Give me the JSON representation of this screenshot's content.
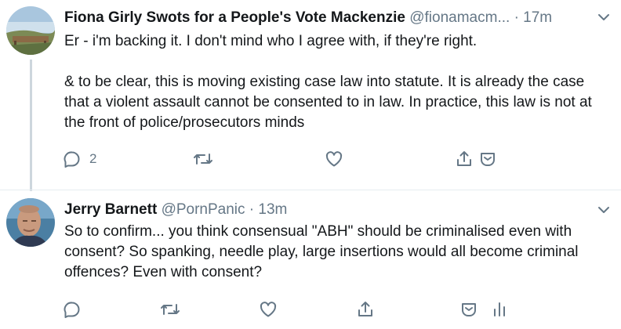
{
  "tweets": [
    {
      "display_name": "Fiona Girly Swots for a People's Vote Mackenzie",
      "handle": "@fionamacm...",
      "separator": "·",
      "time": "17m",
      "text": "Er - i'm backing it. I don't mind who I agree with, if they're right.\n\n& to be clear, this is moving existing case law into statute. It is already the case that a violent assault cannot be consented to in law. In practice, this law is not at the front of police/prosecutors minds",
      "reply_count": "2",
      "icons": [
        "reply-icon",
        "retweet-icon",
        "like-icon",
        "share-icon",
        "dm-icon"
      ]
    },
    {
      "display_name": "Jerry Barnett",
      "handle": "@PornPanic",
      "separator": "·",
      "time": "13m",
      "text": "So to confirm... you think consensual \"ABH\" should be criminalised even with consent? So spanking, needle play, large insertions would all become criminal offences? Even with consent?",
      "reply_count": "",
      "icons": [
        "reply-icon",
        "retweet-icon",
        "like-icon",
        "share-icon",
        "dm-icon",
        "analytics-icon"
      ]
    }
  ],
  "colors": {
    "icon_gray": "#657786",
    "text": "#14171a",
    "thread_line": "#cdd6dd",
    "divider": "#e6ecf0"
  }
}
